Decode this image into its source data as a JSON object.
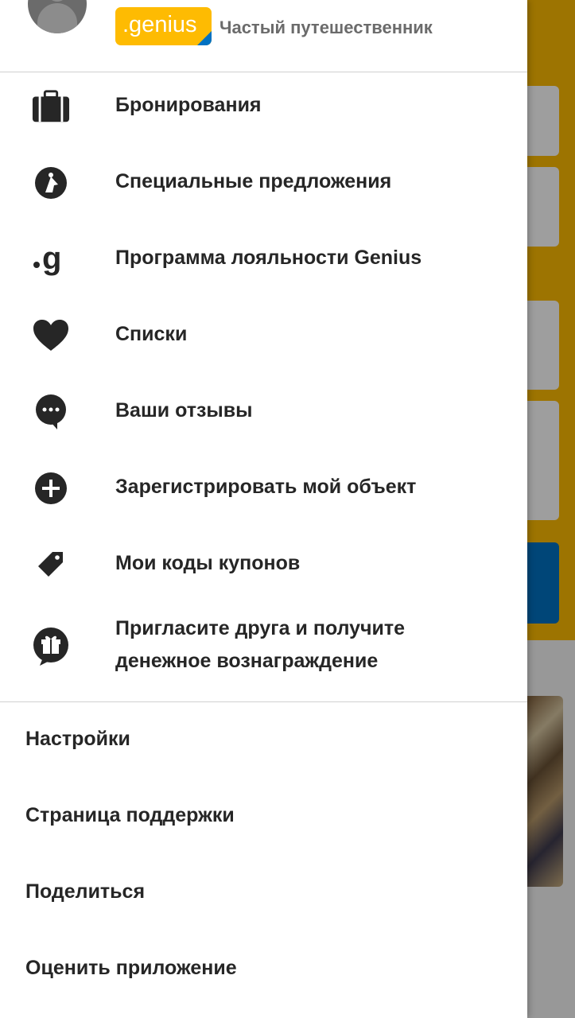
{
  "profile": {
    "badge_text": ".genius",
    "tier": "Частый путешественник"
  },
  "menu": {
    "items": [
      {
        "label": "Бронирования",
        "icon": "briefcase-icon"
      },
      {
        "label": "Специальные предложения",
        "icon": "deals-icon"
      },
      {
        "label": "Программа лояльности Genius",
        "icon": "genius-g-icon"
      },
      {
        "label": "Списки",
        "icon": "heart-icon"
      },
      {
        "label": "Ваши отзывы",
        "icon": "speech-bubble-icon"
      },
      {
        "label": "Зарегистрировать мой объект",
        "icon": "plus-circle-icon"
      },
      {
        "label": "Мои коды купонов",
        "icon": "tag-icon"
      },
      {
        "label": "Пригласите друга и получите денежное вознаграждение",
        "icon": "gift-bubble-icon"
      }
    ]
  },
  "secondary": {
    "items": [
      {
        "label": "Настройки"
      },
      {
        "label": "Страница поддержки"
      },
      {
        "label": "Поделиться"
      },
      {
        "label": "Оценить приложение"
      }
    ]
  },
  "colors": {
    "brand_yellow": "#febb02",
    "brand_blue": "#0071c2",
    "text_dark": "#262626",
    "icon_dark": "#262626"
  }
}
